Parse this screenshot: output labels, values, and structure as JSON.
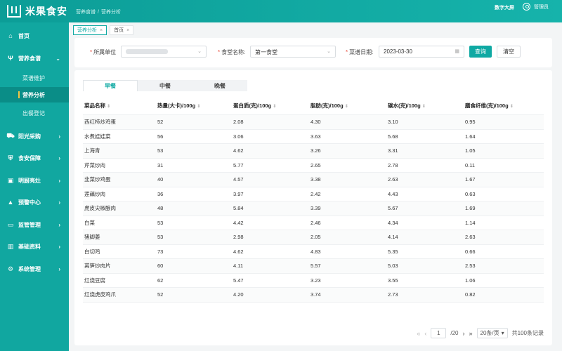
{
  "app": {
    "title": "米果食安"
  },
  "header": {
    "breadcrumb": [
      "营养食谱",
      "营养分析"
    ],
    "screen_link": "数字大屏",
    "user_name": "管理员"
  },
  "sidebar": {
    "items": [
      {
        "label": "首页",
        "icon": "home-icon"
      },
      {
        "label": "营养食谱",
        "icon": "utensils-icon"
      },
      {
        "label": "阳光采购",
        "icon": "truck-icon"
      },
      {
        "label": "食安保障",
        "icon": "shield-icon"
      },
      {
        "label": "明厨亮灶",
        "icon": "camera-icon"
      },
      {
        "label": "预警中心",
        "icon": "warning-icon"
      },
      {
        "label": "监管管理",
        "icon": "monitor-icon"
      },
      {
        "label": "基础资料",
        "icon": "database-icon"
      },
      {
        "label": "系统管理",
        "icon": "gear-icon"
      }
    ],
    "subitems": [
      "菜谱维护",
      "营养分析",
      "出餐登记"
    ]
  },
  "tabs": [
    {
      "label": "营养分析"
    },
    {
      "label": "首页"
    }
  ],
  "filters": {
    "unit_label": "所属单位",
    "canteen_label": "食堂名称:",
    "canteen_value": "第一食堂",
    "date_label": "菜谱日期:",
    "date_value": "2023-03-30",
    "query_label": "查询",
    "clear_label": "清空"
  },
  "meal_tabs": [
    "早餐",
    "中餐",
    "晚餐"
  ],
  "table": {
    "columns": [
      "菜品名称",
      "热量(大卡)/100g",
      "蛋白质(克)/100g",
      "脂肪(克)/100g",
      "碳水(克)/100g",
      "膳食纤维(克)/100g"
    ],
    "rows": [
      [
        "西红柿炒鸡蛋",
        "52",
        "2.08",
        "4.30",
        "3.10",
        "0.95"
      ],
      [
        "水煮娃娃菜",
        "56",
        "3.06",
        "3.63",
        "5.68",
        "1.64"
      ],
      [
        "上海青",
        "53",
        "4.62",
        "3.26",
        "3.31",
        "1.05"
      ],
      [
        "芹菜炒肉",
        "31",
        "5.77",
        "2.65",
        "2.78",
        "0.11"
      ],
      [
        "韭菜炒鸡蛋",
        "40",
        "4.57",
        "3.38",
        "2.63",
        "1.67"
      ],
      [
        "莲藕炒肉",
        "36",
        "3.97",
        "2.42",
        "4.43",
        "0.63"
      ],
      [
        "虎皮尖椒酿肉",
        "48",
        "5.84",
        "3.39",
        "5.67",
        "1.69"
      ],
      [
        "白菜",
        "53",
        "4.42",
        "2.46",
        "4.34",
        "1.14"
      ],
      [
        "猪脚姜",
        "53",
        "2.98",
        "2.05",
        "4.14",
        "2.63"
      ],
      [
        "白切鸡",
        "73",
        "4.62",
        "4.83",
        "5.35",
        "0.66"
      ],
      [
        "莴笋炒肉片",
        "60",
        "4.11",
        "5.57",
        "5.03",
        "2.53"
      ],
      [
        "红烧豆腐",
        "62",
        "5.47",
        "3.23",
        "3.55",
        "1.06"
      ],
      [
        "红烧虎皮鸡爪",
        "52",
        "4.20",
        "3.74",
        "2.73",
        "0.82"
      ]
    ]
  },
  "pager": {
    "current_page": "1",
    "total_pages": "/20",
    "page_size": "20条/页",
    "total": "共100条记录"
  },
  "colors": {
    "accent": "#0fa9a3",
    "sidebar": "#11a7a0"
  }
}
